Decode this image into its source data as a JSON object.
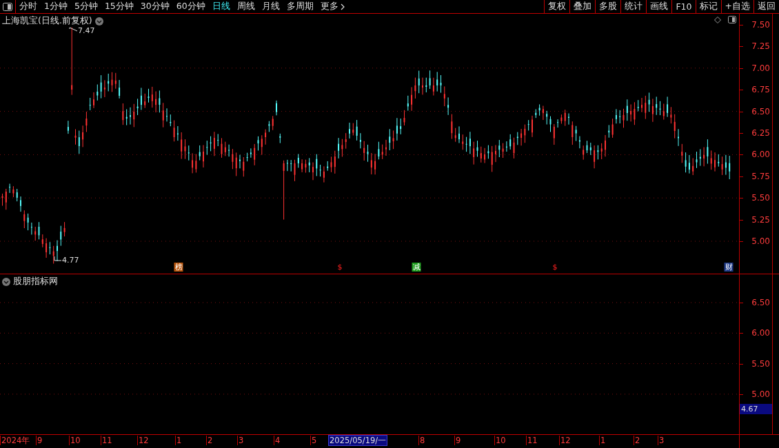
{
  "toolbar": {
    "periods": [
      {
        "label": "分时",
        "selected": false
      },
      {
        "label": "1分钟",
        "selected": false
      },
      {
        "label": "5分钟",
        "selected": false
      },
      {
        "label": "15分钟",
        "selected": false
      },
      {
        "label": "30分钟",
        "selected": false
      },
      {
        "label": "60分钟",
        "selected": false
      },
      {
        "label": "日线",
        "selected": true
      },
      {
        "label": "周线",
        "selected": false
      },
      {
        "label": "月线",
        "selected": false
      },
      {
        "label": "多周期",
        "selected": false
      }
    ],
    "more": "更多",
    "actions": [
      "复权",
      "叠加",
      "多股",
      "统计",
      "画线",
      "F10",
      "标记",
      "+自选",
      "返回"
    ]
  },
  "price_pane": {
    "title": "上海凯宝(日线.前复权)",
    "high_label": "7.47",
    "low_label": "4.77",
    "markers": [
      {
        "kind": "tag",
        "text": "榜",
        "color": "#b8560e"
      },
      {
        "kind": "dollar",
        "text": "$"
      },
      {
        "kind": "tag",
        "text": "减",
        "color": "#1c9a1c"
      },
      {
        "kind": "dollar",
        "text": "$"
      },
      {
        "kind": "tag",
        "text": "财",
        "color": "#1e3a86"
      }
    ],
    "axis_labels": [
      "7.50",
      "7.25",
      "7.00",
      "6.75",
      "6.50",
      "6.25",
      "6.00",
      "5.75",
      "5.50",
      "5.25",
      "5.00"
    ]
  },
  "indicator_pane": {
    "title": "股朋指标网",
    "axis_labels": [
      "6.50",
      "6.00",
      "5.50",
      "5.00"
    ],
    "value_box": "4.67"
  },
  "date_axis": {
    "labels": [
      {
        "text": "2024年",
        "selected": false
      },
      {
        "text": "9",
        "selected": false
      },
      {
        "text": "10",
        "selected": false
      },
      {
        "text": "11",
        "selected": false
      },
      {
        "text": "12",
        "selected": false
      },
      {
        "text": "1",
        "selected": false
      },
      {
        "text": "2",
        "selected": false
      },
      {
        "text": "3",
        "selected": false
      },
      {
        "text": "4",
        "selected": false
      },
      {
        "text": "5",
        "selected": false
      },
      {
        "text": "2025/05/19/一",
        "selected": true
      },
      {
        "text": "8",
        "selected": false
      },
      {
        "text": "9",
        "selected": false
      },
      {
        "text": "10",
        "selected": false
      },
      {
        "text": "11",
        "selected": false
      },
      {
        "text": "12",
        "selected": false
      },
      {
        "text": "1",
        "selected": false
      },
      {
        "text": "2",
        "selected": false
      },
      {
        "text": "3",
        "selected": false
      }
    ]
  }
}
